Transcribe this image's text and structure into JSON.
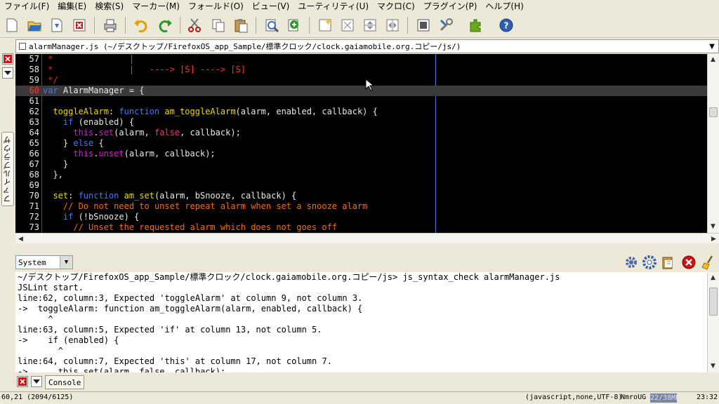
{
  "menu": [
    "ファイル(F)",
    "編集(E)",
    "検索(S)",
    "マーカー(M)",
    "フォールド(O)",
    "ビュー(V)",
    "ユーティリティ(U)",
    "マクロ(C)",
    "プラグイン(P)",
    "ヘルプ(H)"
  ],
  "left_panel": {
    "tab_label": "ファイルブラウザ"
  },
  "document": {
    "title": "alarmManager.js (~/デスクトップ/FirefoxOS_app_Sample/標準クロック/clock.gaiamobile.org.コピー/js/)"
  },
  "editor": {
    "current_line": "60",
    "lines": [
      {
        "num": "57",
        "segments": [
          {
            "cls": "ast",
            "text": " *"
          },
          {
            "cls": "red",
            "text": "               |"
          }
        ]
      },
      {
        "num": "58",
        "segments": [
          {
            "cls": "ast",
            "text": " *"
          },
          {
            "cls": "red",
            "text": "               |   ----> [S] ----> [S]"
          }
        ]
      },
      {
        "num": "59",
        "segments": [
          {
            "cls": "ast",
            "text": " */"
          }
        ]
      },
      {
        "num": "60",
        "segments": [
          {
            "cls": "kw",
            "text": "var"
          },
          {
            "cls": "id",
            "text": " AlarmManager = {"
          }
        ]
      },
      {
        "num": "61",
        "segments": []
      },
      {
        "num": "62",
        "segments": [
          {
            "cls": "prop",
            "text": "  toggleAlarm"
          },
          {
            "cls": "id",
            "text": ": "
          },
          {
            "cls": "kw",
            "text": "function"
          },
          {
            "cls": "fn",
            "text": " am_toggleAlarm"
          },
          {
            "cls": "id",
            "text": "(alarm, enabled, callback) {"
          }
        ]
      },
      {
        "num": "63",
        "segments": [
          {
            "cls": "kw",
            "text": "    if"
          },
          {
            "cls": "id",
            "text": " (enabled) {"
          }
        ]
      },
      {
        "num": "64",
        "segments": [
          {
            "cls": "mag",
            "text": "      this"
          },
          {
            "cls": "id",
            "text": "."
          },
          {
            "cls": "mag",
            "text": "set"
          },
          {
            "cls": "id",
            "text": "(alarm, "
          },
          {
            "cls": "pink",
            "text": "false"
          },
          {
            "cls": "id",
            "text": ", callback);"
          }
        ]
      },
      {
        "num": "65",
        "segments": [
          {
            "cls": "id",
            "text": "    } "
          },
          {
            "cls": "kw",
            "text": "else"
          },
          {
            "cls": "id",
            "text": " {"
          }
        ]
      },
      {
        "num": "66",
        "segments": [
          {
            "cls": "mag",
            "text": "      this"
          },
          {
            "cls": "id",
            "text": "."
          },
          {
            "cls": "mag",
            "text": "unset"
          },
          {
            "cls": "id",
            "text": "(alarm, callback);"
          }
        ]
      },
      {
        "num": "67",
        "segments": [
          {
            "cls": "id",
            "text": "    }"
          }
        ]
      },
      {
        "num": "68",
        "segments": [
          {
            "cls": "id",
            "text": "  },"
          }
        ]
      },
      {
        "num": "69",
        "segments": []
      },
      {
        "num": "70",
        "segments": [
          {
            "cls": "prop",
            "text": "  set"
          },
          {
            "cls": "id",
            "text": ": "
          },
          {
            "cls": "kw",
            "text": "function"
          },
          {
            "cls": "fn",
            "text": " am_set"
          },
          {
            "cls": "id",
            "text": "(alarm, bSnooze, callback) {"
          }
        ]
      },
      {
        "num": "71",
        "segments": [
          {
            "cls": "cm",
            "text": "    // Do not need to unset repeat alarm when set a snooze alarm"
          }
        ]
      },
      {
        "num": "72",
        "segments": [
          {
            "cls": "kw",
            "text": "    if"
          },
          {
            "cls": "id",
            "text": " (!bSnooze) {"
          }
        ]
      },
      {
        "num": "73",
        "segments": [
          {
            "cls": "cm",
            "text": "      // Unset the requested alarm which does not goes off"
          }
        ]
      }
    ]
  },
  "console_panel": {
    "selector_value": "System",
    "lines": [
      "~/デスクトップ/FirefoxOS_app_Sample/標準クロック/clock.gaiamobile.org.コピー/js> js_syntax_check alarmManager.js",
      "JSLint start.",
      "line:62, column:3, Expected 'toggleAlarm' at column 9, not column 3.",
      "->  toggleAlarm: function am_toggleAlarm(alarm, enabled, callback) {",
      "      ^",
      "line:63, column:5, Expected 'if' at column 13, not column 5.",
      "->    if (enabled) {",
      "        ^",
      "line:64, column:7, Expected 'this' at column 17, not column 7.",
      "->      this.set(alarm, false, callback);"
    ],
    "tab_label": "Console"
  },
  "status": {
    "position": "60,21 (2094/6125)",
    "mode": "(javascript,none,UTF-8)",
    "flags": "NmroUG",
    "memory": "22/38MB",
    "time": "23:32"
  }
}
